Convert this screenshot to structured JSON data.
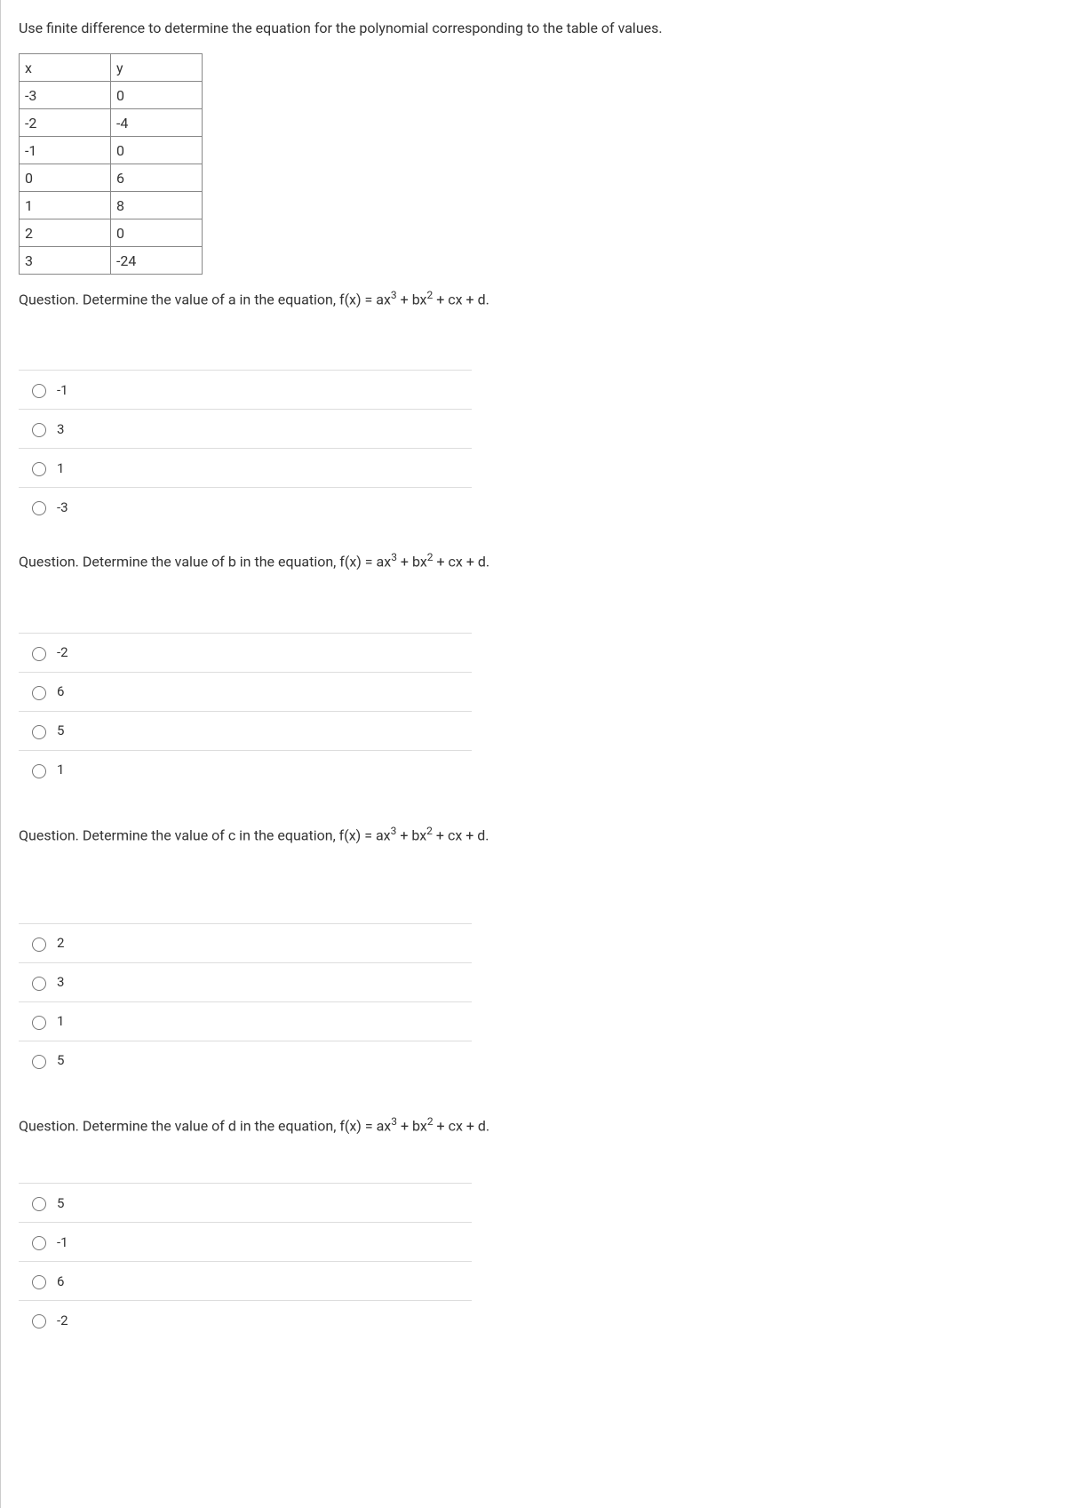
{
  "intro": "Use finite difference to determine the equation for the polynomial corresponding to the table of values.",
  "table": {
    "headers": {
      "x": "x",
      "y": "y"
    },
    "rows": [
      {
        "x": "-3",
        "y": "0"
      },
      {
        "x": "-2",
        "y": "-4"
      },
      {
        "x": "-1",
        "y": "0"
      },
      {
        "x": "0",
        "y": "6"
      },
      {
        "x": "1",
        "y": "8"
      },
      {
        "x": "2",
        "y": "0"
      },
      {
        "x": "3",
        "y": "-24"
      }
    ]
  },
  "questions": [
    {
      "prompt_prefix": "Question. Determine the value of a in the equation, f(x) = ax",
      "prompt_mid1": " + bx",
      "prompt_mid2": " + cx + d.",
      "options": [
        "-1",
        "3",
        "1",
        "-3"
      ]
    },
    {
      "prompt_prefix": "Question. Determine the value of b in the equation, f(x) = ax",
      "prompt_mid1": " + bx",
      "prompt_mid2": " + cx + d.",
      "options": [
        "-2",
        "6",
        "5",
        "1"
      ]
    },
    {
      "prompt_prefix": "Question. Determine the value of c in the equation, f(x) = ax",
      "prompt_mid1": " + bx",
      "prompt_mid2": " + cx + d.",
      "options": [
        "2",
        "3",
        "1",
        "5"
      ]
    },
    {
      "prompt_prefix": "Question. Determine the value of d in the equation, f(x) = ax",
      "prompt_mid1": " + bx",
      "prompt_mid2": " + cx + d.",
      "options": [
        "5",
        "-1",
        "6",
        "-2"
      ]
    }
  ],
  "sup3": "3",
  "sup2": "2"
}
